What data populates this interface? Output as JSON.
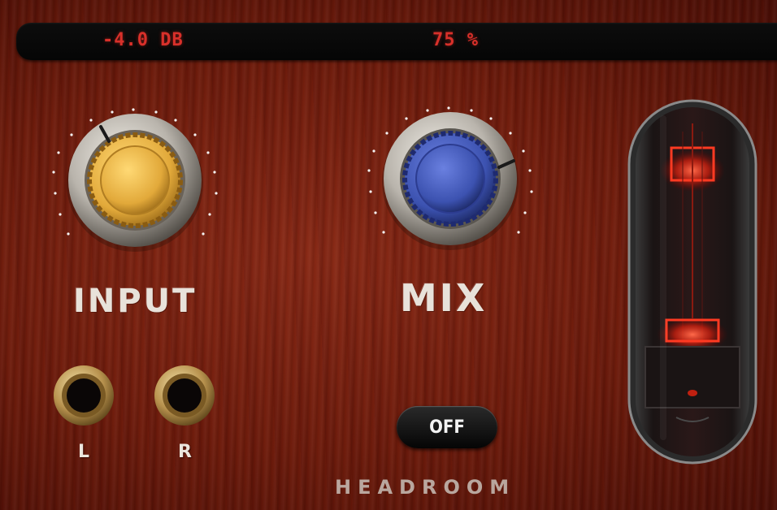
{
  "display": {
    "input_value": "-4.0 DB",
    "mix_value": "75 %"
  },
  "knobs": {
    "input": {
      "label": "INPUT",
      "cap_color": "#e8b94a"
    },
    "mix": {
      "label": "MIX",
      "cap_color": "#3c52b0"
    }
  },
  "jacks": {
    "left_label": "L",
    "right_label": "R"
  },
  "headroom": {
    "toggle_label": "OFF",
    "label": "HEADROOM"
  },
  "colors": {
    "lcd_text": "#d8302a",
    "wood": "#6e1c0c",
    "tube_glow": "#ff2a1a"
  }
}
